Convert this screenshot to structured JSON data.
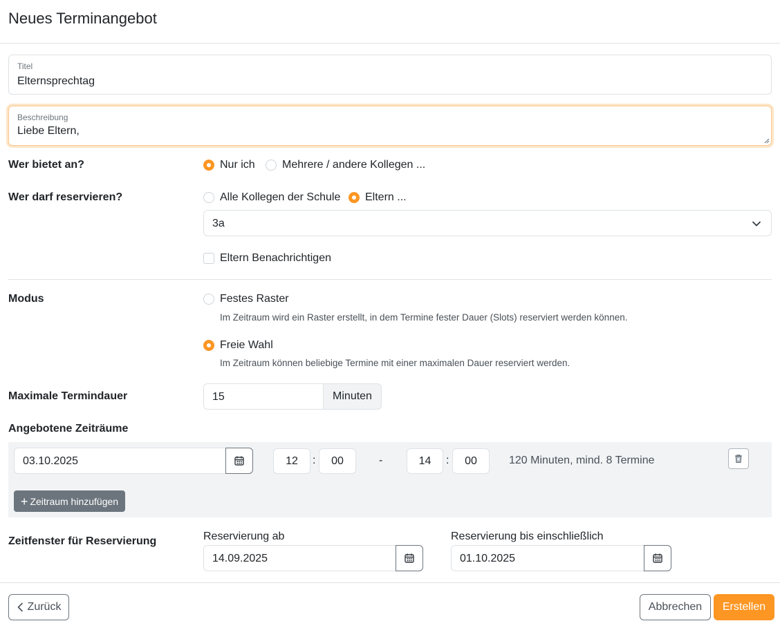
{
  "header": {
    "title": "Neues Terminangebot"
  },
  "title_field": {
    "label": "Titel",
    "value": "Elternsprechtag"
  },
  "description_field": {
    "label": "Beschreibung",
    "value": "Liebe Eltern,"
  },
  "offerer": {
    "label": "Wer bietet an?",
    "options": [
      "Nur ich",
      "Mehrere / andere Kollegen ..."
    ],
    "selected": "Nur ich"
  },
  "reservers": {
    "label": "Wer darf reservieren?",
    "options": [
      "Alle Kollegen der Schule",
      "Eltern ..."
    ],
    "selected": "Eltern ...",
    "class_select": {
      "value": "3a"
    },
    "notify_label": "Eltern Benachrichtigen",
    "notify_checked": false
  },
  "mode": {
    "label": "Modus",
    "options": [
      {
        "label": "Festes Raster",
        "help": "Im Zeitraum wird ein Raster erstellt, in dem Termine fester Dauer (Slots) reserviert werden können."
      },
      {
        "label": "Freie Wahl",
        "help": "Im Zeitraum können beliebige Termine mit einer maximalen Dauer reserviert werden."
      }
    ],
    "selected": "Freie Wahl"
  },
  "max_duration": {
    "label": "Maximale Termindauer",
    "value": "15",
    "unit": "Minuten"
  },
  "periods": {
    "label": "Angebotene Zeiträume",
    "items": [
      {
        "date": "03.10.2025",
        "start_h": "12",
        "start_m": "00",
        "end_h": "14",
        "end_m": "00",
        "info": "120 Minuten, mind. 8 Termine"
      }
    ],
    "time_sep": ":",
    "range_sep": "-",
    "add_label": "Zeitraum hinzufügen"
  },
  "reservation_window": {
    "label": "Zeitfenster für Reservierung",
    "from_label": "Reservierung ab",
    "from_value": "14.09.2025",
    "to_label": "Reservierung bis einschließlich",
    "to_value": "01.10.2025"
  },
  "footer": {
    "back_label": "Zurück",
    "cancel_label": "Abbrechen",
    "create_label": "Erstellen"
  },
  "colors": {
    "accent": "#fd9623",
    "secondary": "#6c757d",
    "border": "#dee2e6"
  },
  "icons": [
    "calendar-icon",
    "trash-icon",
    "chevron-down-icon",
    "chevron-left-icon",
    "plus-icon"
  ]
}
